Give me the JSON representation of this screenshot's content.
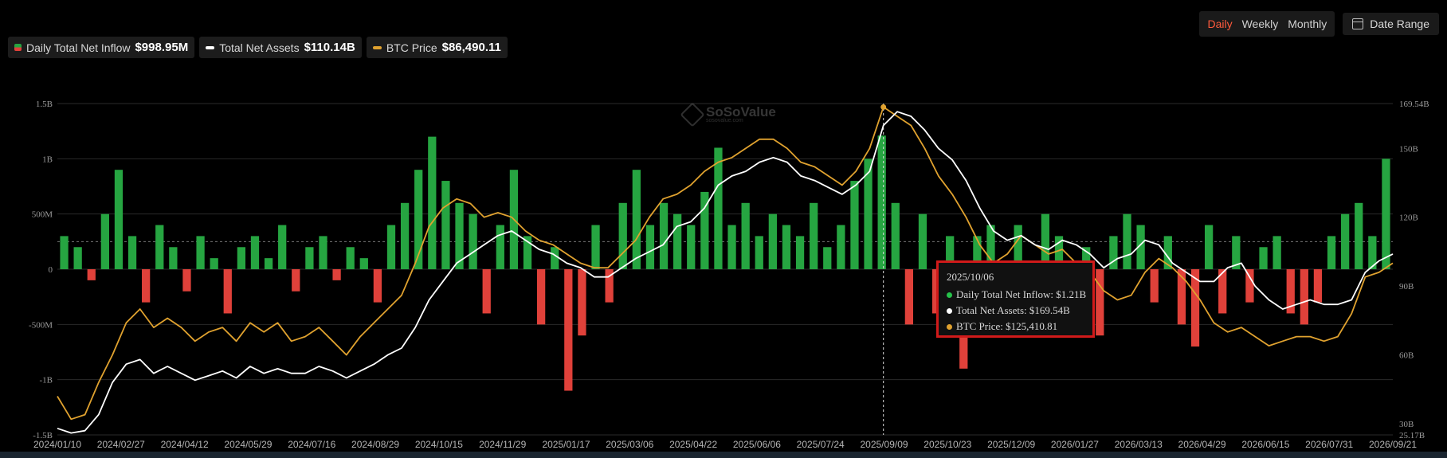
{
  "controls": {
    "periods": [
      {
        "label": "Daily",
        "active": true
      },
      {
        "label": "Weekly",
        "active": false
      },
      {
        "label": "Monthly",
        "active": false
      }
    ],
    "date_range_label": "Date Range"
  },
  "legend": [
    {
      "label": "Daily Total Net Inflow",
      "value": "$998.95M",
      "icon": "green-red-square"
    },
    {
      "label": "Total Net Assets",
      "value": "$110.14B",
      "icon": "white-line"
    },
    {
      "label": "BTC Price",
      "value": "$86,490.11",
      "icon": "orange-line"
    }
  ],
  "watermark": {
    "text": "SoSoValue",
    "sub": "sosovalue.com"
  },
  "tooltip": {
    "date": "2025/10/06",
    "rows": [
      {
        "text": "Daily Total Net Inflow: $1.21B",
        "color": "#26c24a"
      },
      {
        "text": "Total Net Assets: $169.54B",
        "color": "#ffffff"
      },
      {
        "text": "BTC Price: $125,410.81",
        "color": "#e0a22f"
      }
    ]
  },
  "chart_data": {
    "type": "bar+line",
    "x_ticks": [
      "2024/01/10",
      "2024/02/27",
      "2024/04/12",
      "2024/05/29",
      "2024/07/16",
      "2024/08/29",
      "2024/10/15",
      "2024/11/29",
      "2025/01/17",
      "2025/03/06",
      "2025/04/22",
      "2025/06/06",
      "2025/07/24",
      "2025/09/09",
      "2025/10/23",
      "2025/12/09",
      "2026/01/27",
      "2026/03/13",
      "2026/04/29",
      "2026/06/15",
      "2026/07/31",
      "2026/09/21"
    ],
    "y_left_ticks": [
      "1.5B",
      "1B",
      "500M",
      "0",
      "-500M",
      "-1B",
      "-1.5B"
    ],
    "y_left_range": [
      -1.5,
      1.5
    ],
    "y_right_ticks": [
      "169.54B",
      "150B",
      "120B",
      "90B",
      "60B",
      "30B",
      "25.17B"
    ],
    "y_right_range": [
      25.17,
      169.54
    ],
    "colors": {
      "inflow": "#26a541",
      "outflow": "#e0413a",
      "assets": "#ffffff",
      "btc": "#e0a22f",
      "grid": "#2a2a2a"
    },
    "series": [
      {
        "name": "Total Net Assets",
        "unit": "B",
        "values": [
          28,
          26,
          27,
          34,
          48,
          56,
          58,
          52,
          55,
          52,
          49,
          51,
          53,
          50,
          55,
          52,
          54,
          52,
          52,
          55,
          53,
          50,
          53,
          56,
          60,
          63,
          72,
          84,
          92,
          100,
          104,
          108,
          112,
          114,
          110,
          106,
          104,
          100,
          98,
          94,
          94,
          98,
          102,
          105,
          108,
          116,
          118,
          124,
          134,
          138,
          140,
          144,
          146,
          144,
          138,
          136,
          133,
          130,
          134,
          140,
          160,
          166,
          164,
          158,
          150,
          145,
          136,
          124,
          114,
          110,
          112,
          108,
          106,
          110,
          108,
          104,
          98,
          102,
          104,
          110,
          108,
          100,
          96,
          92,
          92,
          98,
          100,
          90,
          84,
          80,
          82,
          84,
          82,
          82,
          84,
          96,
          101,
          104
        ]
      },
      {
        "name": "BTC Price",
        "unit": "B",
        "values": [
          42,
          32,
          34,
          48,
          60,
          74,
          80,
          72,
          76,
          72,
          66,
          70,
          72,
          66,
          74,
          70,
          74,
          66,
          68,
          72,
          66,
          60,
          68,
          74,
          80,
          86,
          100,
          116,
          124,
          128,
          126,
          120,
          122,
          120,
          114,
          110,
          108,
          104,
          100,
          98,
          98,
          104,
          110,
          120,
          128,
          130,
          134,
          140,
          144,
          146,
          150,
          154,
          154,
          150,
          144,
          142,
          138,
          134,
          140,
          150,
          168,
          164,
          160,
          150,
          138,
          130,
          120,
          108,
          100,
          104,
          112,
          108,
          104,
          106,
          100,
          96,
          88,
          84,
          86,
          96,
          102,
          98,
          92,
          84,
          74,
          70,
          72,
          68,
          64,
          66,
          68,
          68,
          66,
          68,
          78,
          94,
          96,
          100
        ]
      },
      {
        "name": "Daily Total Net Inflow",
        "unit": "B",
        "values": [
          0.3,
          0.2,
          -0.1,
          0.5,
          0.9,
          0.3,
          -0.3,
          0.4,
          0.2,
          -0.2,
          0.3,
          0.1,
          -0.4,
          0.2,
          0.3,
          0.1,
          0.4,
          -0.2,
          0.2,
          0.3,
          -0.1,
          0.2,
          0.1,
          -0.3,
          0.4,
          0.6,
          0.9,
          1.2,
          0.8,
          0.6,
          0.5,
          -0.4,
          0.4,
          0.9,
          0.3,
          -0.5,
          0.2,
          -1.1,
          -0.6,
          0.4,
          -0.3,
          0.6,
          0.9,
          0.4,
          0.6,
          0.5,
          0.4,
          0.7,
          1.1,
          0.4,
          0.6,
          0.3,
          0.5,
          0.4,
          0.3,
          0.6,
          0.2,
          0.4,
          0.8,
          1.0,
          1.21,
          0.6,
          -0.5,
          0.5,
          -0.4,
          0.3,
          -0.9,
          0.3,
          0.4,
          -0.6,
          0.4,
          -0.3,
          0.5,
          0.3,
          -0.4,
          0.2,
          -0.6,
          0.3,
          0.5,
          0.4,
          -0.3,
          0.3,
          -0.5,
          -0.7,
          0.4,
          -0.4,
          0.3,
          -0.3,
          0.2,
          0.3,
          -0.4,
          -0.5,
          -0.3,
          0.3,
          0.5,
          0.6,
          0.3,
          1.0
        ]
      }
    ],
    "tooltip_index": 60
  }
}
